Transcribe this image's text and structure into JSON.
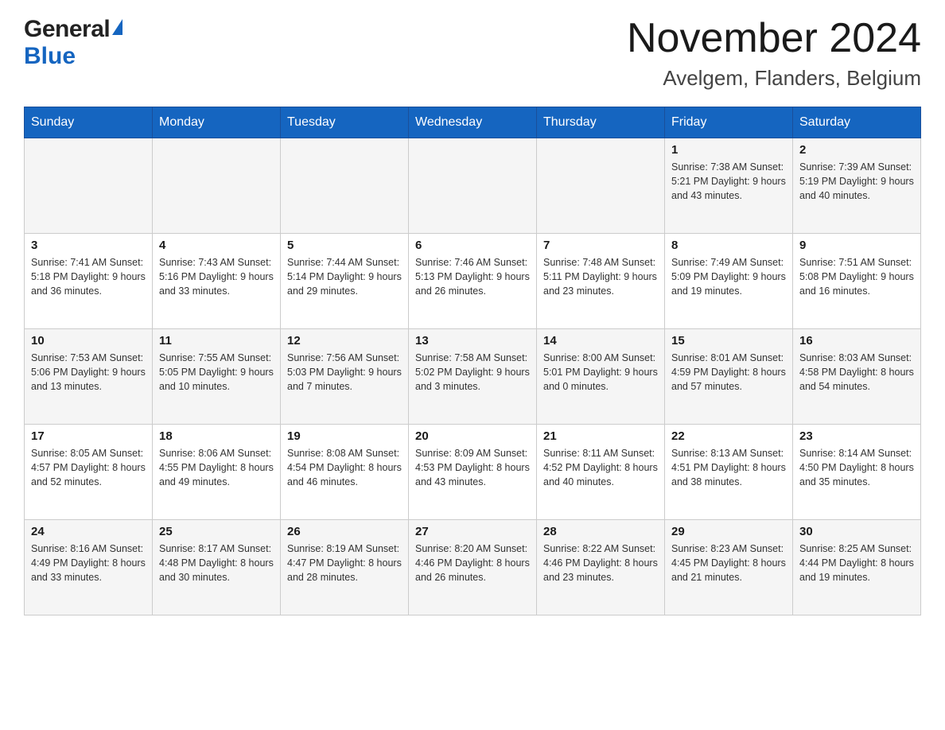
{
  "header": {
    "logo_general": "General",
    "logo_blue": "Blue",
    "title": "November 2024",
    "subtitle": "Avelgem, Flanders, Belgium"
  },
  "calendar": {
    "days_of_week": [
      "Sunday",
      "Monday",
      "Tuesday",
      "Wednesday",
      "Thursday",
      "Friday",
      "Saturday"
    ],
    "weeks": [
      [
        {
          "day": "",
          "info": ""
        },
        {
          "day": "",
          "info": ""
        },
        {
          "day": "",
          "info": ""
        },
        {
          "day": "",
          "info": ""
        },
        {
          "day": "",
          "info": ""
        },
        {
          "day": "1",
          "info": "Sunrise: 7:38 AM\nSunset: 5:21 PM\nDaylight: 9 hours and 43 minutes."
        },
        {
          "day": "2",
          "info": "Sunrise: 7:39 AM\nSunset: 5:19 PM\nDaylight: 9 hours and 40 minutes."
        }
      ],
      [
        {
          "day": "3",
          "info": "Sunrise: 7:41 AM\nSunset: 5:18 PM\nDaylight: 9 hours and 36 minutes."
        },
        {
          "day": "4",
          "info": "Sunrise: 7:43 AM\nSunset: 5:16 PM\nDaylight: 9 hours and 33 minutes."
        },
        {
          "day": "5",
          "info": "Sunrise: 7:44 AM\nSunset: 5:14 PM\nDaylight: 9 hours and 29 minutes."
        },
        {
          "day": "6",
          "info": "Sunrise: 7:46 AM\nSunset: 5:13 PM\nDaylight: 9 hours and 26 minutes."
        },
        {
          "day": "7",
          "info": "Sunrise: 7:48 AM\nSunset: 5:11 PM\nDaylight: 9 hours and 23 minutes."
        },
        {
          "day": "8",
          "info": "Sunrise: 7:49 AM\nSunset: 5:09 PM\nDaylight: 9 hours and 19 minutes."
        },
        {
          "day": "9",
          "info": "Sunrise: 7:51 AM\nSunset: 5:08 PM\nDaylight: 9 hours and 16 minutes."
        }
      ],
      [
        {
          "day": "10",
          "info": "Sunrise: 7:53 AM\nSunset: 5:06 PM\nDaylight: 9 hours and 13 minutes."
        },
        {
          "day": "11",
          "info": "Sunrise: 7:55 AM\nSunset: 5:05 PM\nDaylight: 9 hours and 10 minutes."
        },
        {
          "day": "12",
          "info": "Sunrise: 7:56 AM\nSunset: 5:03 PM\nDaylight: 9 hours and 7 minutes."
        },
        {
          "day": "13",
          "info": "Sunrise: 7:58 AM\nSunset: 5:02 PM\nDaylight: 9 hours and 3 minutes."
        },
        {
          "day": "14",
          "info": "Sunrise: 8:00 AM\nSunset: 5:01 PM\nDaylight: 9 hours and 0 minutes."
        },
        {
          "day": "15",
          "info": "Sunrise: 8:01 AM\nSunset: 4:59 PM\nDaylight: 8 hours and 57 minutes."
        },
        {
          "day": "16",
          "info": "Sunrise: 8:03 AM\nSunset: 4:58 PM\nDaylight: 8 hours and 54 minutes."
        }
      ],
      [
        {
          "day": "17",
          "info": "Sunrise: 8:05 AM\nSunset: 4:57 PM\nDaylight: 8 hours and 52 minutes."
        },
        {
          "day": "18",
          "info": "Sunrise: 8:06 AM\nSunset: 4:55 PM\nDaylight: 8 hours and 49 minutes."
        },
        {
          "day": "19",
          "info": "Sunrise: 8:08 AM\nSunset: 4:54 PM\nDaylight: 8 hours and 46 minutes."
        },
        {
          "day": "20",
          "info": "Sunrise: 8:09 AM\nSunset: 4:53 PM\nDaylight: 8 hours and 43 minutes."
        },
        {
          "day": "21",
          "info": "Sunrise: 8:11 AM\nSunset: 4:52 PM\nDaylight: 8 hours and 40 minutes."
        },
        {
          "day": "22",
          "info": "Sunrise: 8:13 AM\nSunset: 4:51 PM\nDaylight: 8 hours and 38 minutes."
        },
        {
          "day": "23",
          "info": "Sunrise: 8:14 AM\nSunset: 4:50 PM\nDaylight: 8 hours and 35 minutes."
        }
      ],
      [
        {
          "day": "24",
          "info": "Sunrise: 8:16 AM\nSunset: 4:49 PM\nDaylight: 8 hours and 33 minutes."
        },
        {
          "day": "25",
          "info": "Sunrise: 8:17 AM\nSunset: 4:48 PM\nDaylight: 8 hours and 30 minutes."
        },
        {
          "day": "26",
          "info": "Sunrise: 8:19 AM\nSunset: 4:47 PM\nDaylight: 8 hours and 28 minutes."
        },
        {
          "day": "27",
          "info": "Sunrise: 8:20 AM\nSunset: 4:46 PM\nDaylight: 8 hours and 26 minutes."
        },
        {
          "day": "28",
          "info": "Sunrise: 8:22 AM\nSunset: 4:46 PM\nDaylight: 8 hours and 23 minutes."
        },
        {
          "day": "29",
          "info": "Sunrise: 8:23 AM\nSunset: 4:45 PM\nDaylight: 8 hours and 21 minutes."
        },
        {
          "day": "30",
          "info": "Sunrise: 8:25 AM\nSunset: 4:44 PM\nDaylight: 8 hours and 19 minutes."
        }
      ]
    ]
  }
}
